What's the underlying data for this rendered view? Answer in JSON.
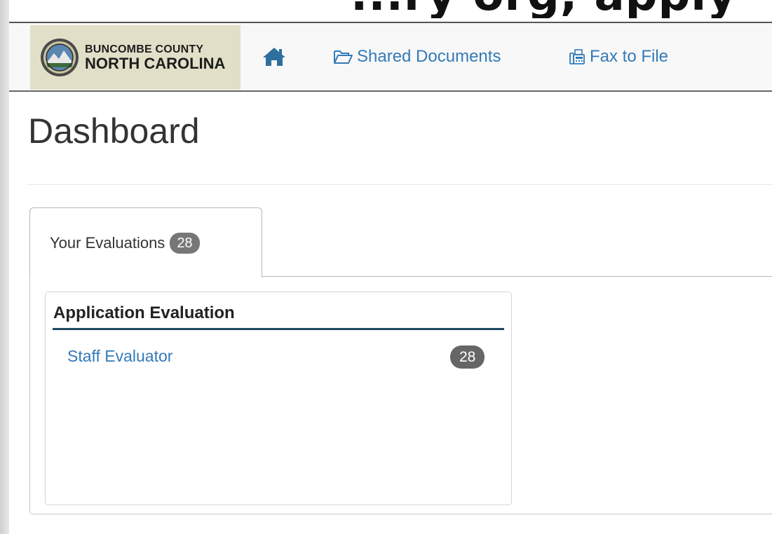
{
  "top_banner_text": "...ry org, apply",
  "navbar": {
    "logo": {
      "line1": "BUNCOMBE COUNTY",
      "line2": "NORTH CAROLINA"
    },
    "home_icon": "home-icon",
    "links": {
      "shared_documents": "Shared Documents",
      "fax_to_file": "Fax to File"
    },
    "link_color": "#337ab7"
  },
  "page": {
    "title": "Dashboard"
  },
  "tabs": {
    "active": {
      "label": "Your Evaluations",
      "count": "28"
    }
  },
  "card": {
    "title": "Application Evaluation",
    "accent_color": "#1f4963",
    "items": [
      {
        "label": "Staff Evaluator",
        "count": "28"
      }
    ]
  }
}
